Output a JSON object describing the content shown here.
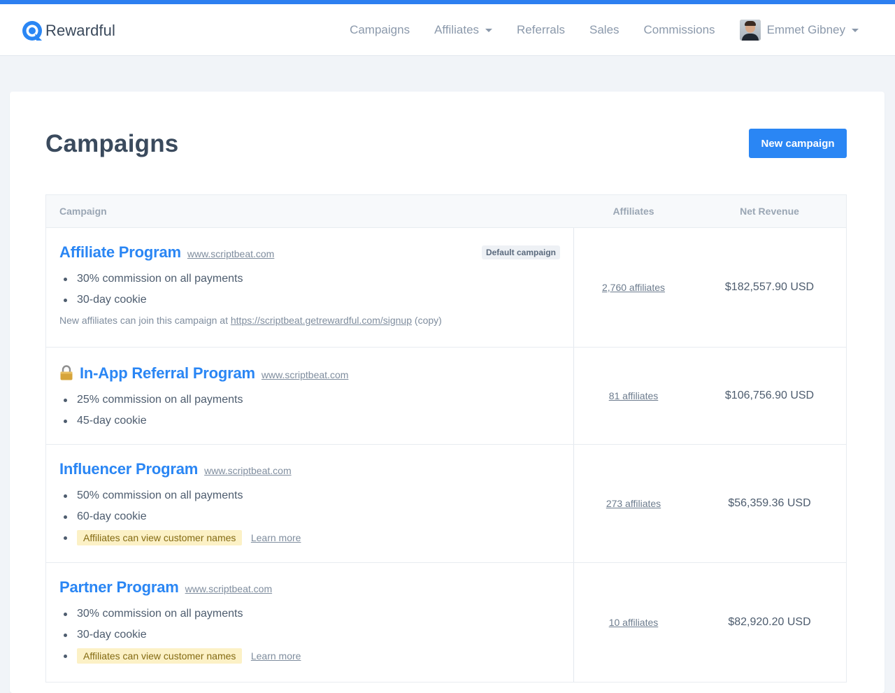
{
  "brand": {
    "name": "Rewardful",
    "accent": "#2a86f4"
  },
  "nav": {
    "items": [
      {
        "label": "Campaigns",
        "dropdown": false
      },
      {
        "label": "Affiliates",
        "dropdown": true
      },
      {
        "label": "Referrals",
        "dropdown": false
      },
      {
        "label": "Sales",
        "dropdown": false
      },
      {
        "label": "Commissions",
        "dropdown": false
      }
    ],
    "user": {
      "name": "Emmet Gibney",
      "dropdown": true
    }
  },
  "page": {
    "title": "Campaigns",
    "new_button": "New campaign"
  },
  "table": {
    "headers": {
      "campaign": "Campaign",
      "affiliates": "Affiliates",
      "revenue": "Net Revenue"
    },
    "rows": [
      {
        "name": "Affiliate Program",
        "url": "www.scriptbeat.com",
        "locked": false,
        "badge": "Default campaign",
        "details": [
          "30% commission on all payments",
          "30-day cookie"
        ],
        "highlight": null,
        "join_prefix": "New affiliates can join this campaign at",
        "join_url": "https://scriptbeat.getrewardful.com/signup",
        "join_copy": "(copy)",
        "affiliates": "2,760 affiliates",
        "revenue": "$182,557.90 USD"
      },
      {
        "name": "In-App Referral Program",
        "url": "www.scriptbeat.com",
        "locked": true,
        "details": [
          "25% commission on all payments",
          "45-day cookie"
        ],
        "affiliates": "81 affiliates",
        "revenue": "$106,756.90 USD"
      },
      {
        "name": "Influencer Program",
        "url": "www.scriptbeat.com",
        "locked": false,
        "details": [
          "50% commission on all payments",
          "60-day cookie"
        ],
        "highlight": "Affiliates can view customer names",
        "learn_more": "Learn more",
        "affiliates": "273 affiliates",
        "revenue": "$56,359.36 USD"
      },
      {
        "name": "Partner Program",
        "url": "www.scriptbeat.com",
        "locked": false,
        "details": [
          "30% commission on all payments",
          "30-day cookie"
        ],
        "highlight": "Affiliates can view customer names",
        "learn_more": "Learn more",
        "affiliates": "10 affiliates",
        "revenue": "$82,920.20 USD"
      }
    ]
  }
}
